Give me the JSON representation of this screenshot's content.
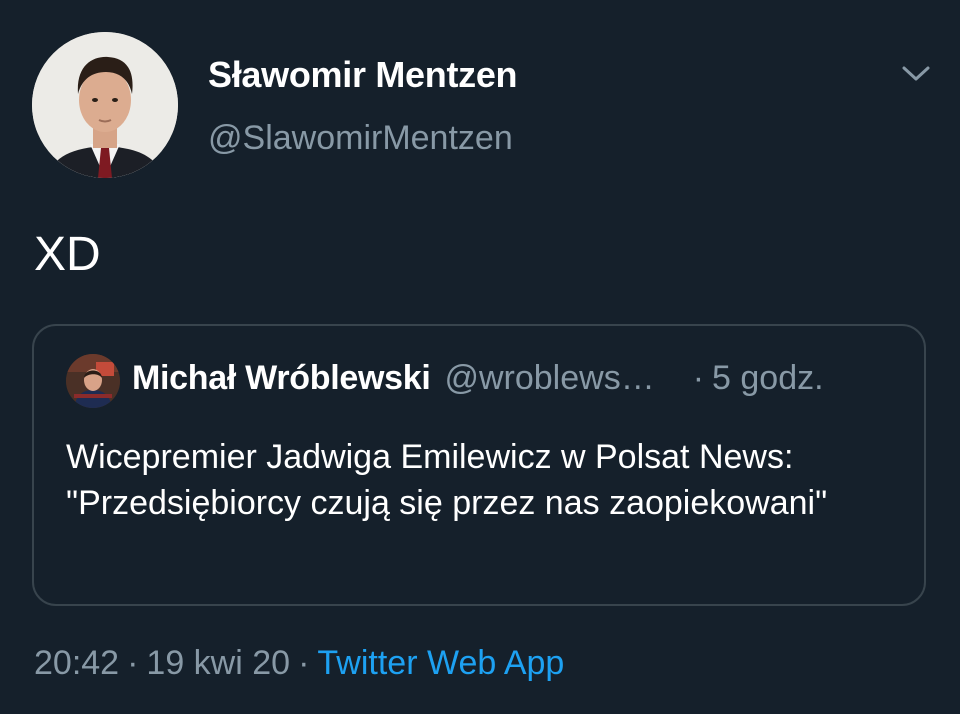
{
  "tweet": {
    "author": {
      "display_name": "Sławomir Mentzen",
      "handle": "@SlawomirMentzen",
      "avatar": "profile-photo"
    },
    "text": "XD",
    "menu_icon": "chevron-down-icon",
    "quoted": {
      "author": {
        "display_name": "Michał Wróblewski",
        "handle": "@wroblews…",
        "avatar": "profile-photo"
      },
      "separator": "·",
      "time_ago": "5 godz.",
      "text": "Wicepremier Jadwiga Emilewicz w Polsat News: \"Przedsiębiorcy czują się przez nas zaopiekowani\""
    },
    "meta": {
      "time": "20:42",
      "separator": "·",
      "date": "19 kwi 20",
      "source": "Twitter Web App"
    }
  },
  "colors": {
    "background": "#15202b",
    "text_primary": "#ffffff",
    "text_secondary": "#8899a6",
    "accent": "#1da1f2",
    "border": "#38444d"
  }
}
